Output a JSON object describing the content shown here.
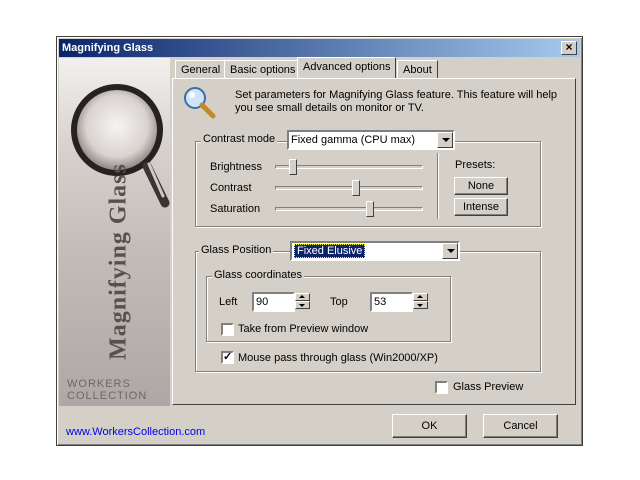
{
  "window": {
    "title": "Magnifying Glass",
    "close_glyph": "×"
  },
  "banner": {
    "vertical_title": "Magnifying Glass",
    "workers_line1": "WORKERS",
    "workers_line2": "COLLECTION",
    "icon": "magnifying-glass-photo"
  },
  "tabs": [
    {
      "label": "General",
      "active": false
    },
    {
      "label": "Basic options",
      "active": false
    },
    {
      "label": "Advanced options",
      "active": true
    },
    {
      "label": "About",
      "active": false
    }
  ],
  "description": "Set parameters for Magnifying Glass feature. This feature will help you see small details on monitor or TV.",
  "contrast": {
    "label": "Contrast mode",
    "mode_value": "Fixed gamma (CPU max)",
    "sliders": [
      {
        "label": "Brightness",
        "level": 0.1
      },
      {
        "label": "Contrast",
        "level": 0.55
      },
      {
        "label": "Saturation",
        "level": 0.65
      }
    ],
    "presets_label": "Presets:",
    "preset_none": "None",
    "preset_intense": "Intense"
  },
  "glass_position": {
    "label": "Glass Position",
    "value": "Fixed Elusive",
    "highlight_color": "#0a246a",
    "coords_label": "Glass coordinates",
    "left_label": "Left",
    "left_value": "90",
    "top_label": "Top",
    "top_value": "53",
    "take_from_preview": "Take from Preview window",
    "take_from_preview_checked": false,
    "mouse_pass": "Mouse pass through glass (Win2000/XP)",
    "mouse_pass_checked": true
  },
  "glass_preview": {
    "label": "Glass Preview",
    "checked": false
  },
  "footer": {
    "link": "www.WorkersCollection.com",
    "ok": "OK",
    "cancel": "Cancel"
  },
  "colors": {
    "titlebar": "#0a246a",
    "face": "#d4d0c8",
    "link": "#0000ee"
  }
}
